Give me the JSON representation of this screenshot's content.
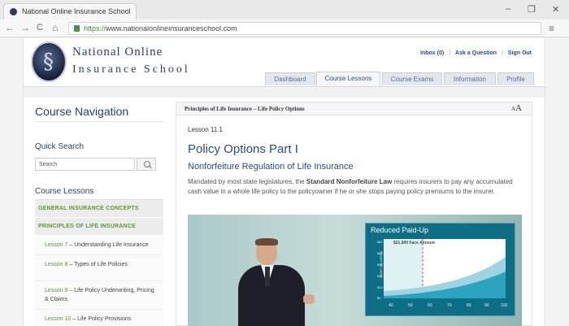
{
  "browser": {
    "tab_title": "National Online Insurance School",
    "url_https": "https://",
    "url_rest": "www.nationalonlineinsuranceschool.com",
    "win_min": "–",
    "win_restore": "❐",
    "win_close": "✕",
    "back": "←",
    "forward": "→",
    "reload": "C",
    "home": "⌂",
    "menu": "≡"
  },
  "header": {
    "logo_glyph": "§",
    "brand_line1": "National Online",
    "brand_line2": "Insurance School",
    "links": [
      "Inbox (0)",
      "Ask a Question",
      "Sign Out"
    ],
    "separator": "|"
  },
  "tabs": [
    "Dashboard",
    "Course Lessons",
    "Course Exams",
    "Information",
    "Profile"
  ],
  "active_tab": "Course Lessons",
  "sidebar": {
    "title": "Course Navigation",
    "quick_search_label": "Quick Search",
    "search_placeholder": "Search",
    "lessons_heading": "Course Lessons",
    "category1": "GENERAL INSURANCE CONCEPTS",
    "category2": "PRINCIPLES OF LIFE INSURANCE",
    "lessons": [
      {
        "num": "Lesson 7",
        "text": " – Understanding Life Insurance"
      },
      {
        "num": "Lesson 8",
        "text": " – Types of Life Policies"
      },
      {
        "num": "Lesson 9",
        "text": " – Life Policy Underwriting, Pricing & Claims"
      },
      {
        "num": "Lesson 10",
        "text": " – Life Policy Provisions"
      }
    ]
  },
  "content": {
    "breadcrumb": "Principles of Life Insurance – Life Policy Options",
    "font_small": "A",
    "font_big": "A",
    "lesson_number": "Lesson 11.1",
    "title": "Policy Options Part I",
    "subtitle": "Nonforfeiture Regulation of Life Insurance",
    "para_before": "Mandated by most state legislatures, the ",
    "para_bold": "Standard Nonforfeiture Law",
    "para_after": " requires insurers to pay any accumulated cash value in a whole life policy to the policyowner if he or she stops paying policy premiums to the insurer."
  },
  "video": {
    "chart_title": "Reduced Paid-Up",
    "chart_note": "$21,500 Face Amount",
    "y_axis_label": "CASH VALUE/000",
    "y_ticks": [
      "$50",
      "$40",
      "$30",
      "$20",
      "$10",
      "$0"
    ],
    "x_ticks": [
      "40",
      "50",
      "60",
      "70",
      "80",
      "90",
      "100"
    ]
  }
}
